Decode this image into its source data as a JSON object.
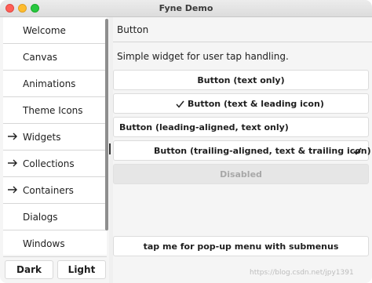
{
  "window": {
    "title": "Fyne Demo"
  },
  "sidebar": {
    "items": [
      {
        "label": "Welcome"
      },
      {
        "label": "Canvas"
      },
      {
        "label": "Animations"
      },
      {
        "label": "Theme Icons"
      },
      {
        "label": "Widgets",
        "expandable": true
      },
      {
        "label": "Collections",
        "expandable": true
      },
      {
        "label": "Containers",
        "expandable": true
      },
      {
        "label": "Dialogs"
      },
      {
        "label": "Windows"
      }
    ],
    "theme_buttons": {
      "dark": "Dark",
      "light": "Light"
    }
  },
  "main": {
    "title": "Button",
    "subtitle": "Simple widget for user tap handling.",
    "buttons": [
      {
        "label": "Button (text only)"
      },
      {
        "label": "Button (text & leading icon)",
        "icon": "check-icon"
      },
      {
        "label": "Button (leading-aligned, text only)"
      },
      {
        "label": "Button (trailing-aligned, text & trailing icon)",
        "icon": "check-icon"
      },
      {
        "label": "Disabled",
        "disabled": true
      },
      {
        "label": "tap me for pop-up menu with submenus"
      }
    ]
  },
  "watermark": "https://blog.csdn.net/jpy1391"
}
